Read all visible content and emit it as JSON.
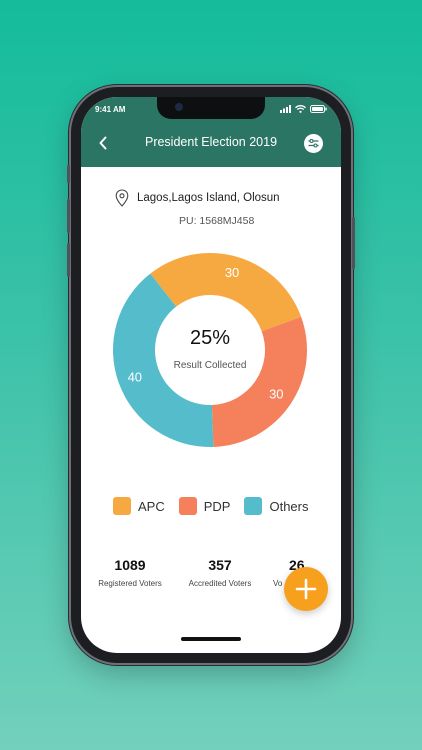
{
  "status_bar": {
    "time": "9:41 AM"
  },
  "header": {
    "title": "President Election 2019"
  },
  "location": {
    "name": "Lagos,Lagos Island, Olosun",
    "pu": "PU: 1568MJ458"
  },
  "chart_data": {
    "type": "pie",
    "categories": [
      "APC",
      "PDP",
      "Others"
    ],
    "values": [
      30,
      30,
      40
    ],
    "colors": [
      "#f7a941",
      "#f5805c",
      "#54bccb"
    ],
    "center_value": "25%",
    "center_label": "Result Collected"
  },
  "legend": [
    {
      "label": "APC",
      "color": "#f7a941"
    },
    {
      "label": "PDP",
      "color": "#f5805c"
    },
    {
      "label": "Others",
      "color": "#54bccb"
    }
  ],
  "stats": [
    {
      "value": "1089",
      "label": "Registered Voters"
    },
    {
      "value": "357",
      "label": "Accredited Voters"
    },
    {
      "value": "26",
      "label": "Vo"
    }
  ],
  "colors": {
    "header": "#2b7565",
    "fab": "#f6a01d",
    "background": "#14bc9c"
  }
}
